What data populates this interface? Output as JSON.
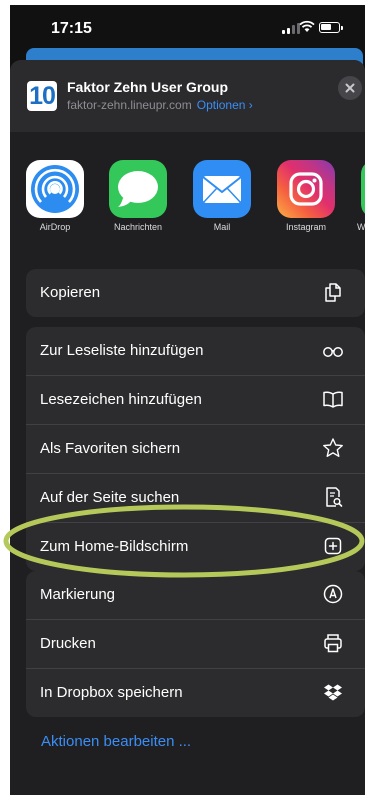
{
  "status": {
    "time": "17:15"
  },
  "header": {
    "app_icon_text": "10",
    "title": "Faktor Zehn User Group",
    "domain": "faktor-zehn.lineupr.com",
    "options_link": "Optionen ›"
  },
  "apps": [
    {
      "label": "AirDrop",
      "icon": "airdrop-icon"
    },
    {
      "label": "Nachrichten",
      "icon": "messages-icon"
    },
    {
      "label": "Mail",
      "icon": "mail-icon"
    },
    {
      "label": "Instagram",
      "icon": "instagram-icon"
    },
    {
      "label": "W",
      "icon": "app-icon"
    }
  ],
  "actions": {
    "copy": {
      "label": "Kopieren",
      "icon": "copy-icon"
    },
    "main": [
      {
        "label": "Zur Leseliste hinzufügen",
        "icon": "glasses-icon"
      },
      {
        "label": "Lesezeichen hinzufügen",
        "icon": "book-icon"
      },
      {
        "label": "Als Favoriten sichern",
        "icon": "star-icon"
      },
      {
        "label": "Auf der Seite suchen",
        "icon": "find-in-page-icon"
      },
      {
        "label": "Zum Home-Bildschirm",
        "icon": "add-square-icon"
      }
    ],
    "more": [
      {
        "label": "Markierung",
        "icon": "markup-icon"
      },
      {
        "label": "Drucken",
        "icon": "printer-icon"
      },
      {
        "label": "In Dropbox speichern",
        "icon": "dropbox-icon"
      }
    ],
    "edit_link": "Aktionen bearbeiten ..."
  },
  "colors": {
    "sheet_bg": "#1f1f21",
    "row_bg": "#2c2c2e",
    "accent": "#3a8ef6",
    "highlight_ellipse": "#b5c85a"
  }
}
